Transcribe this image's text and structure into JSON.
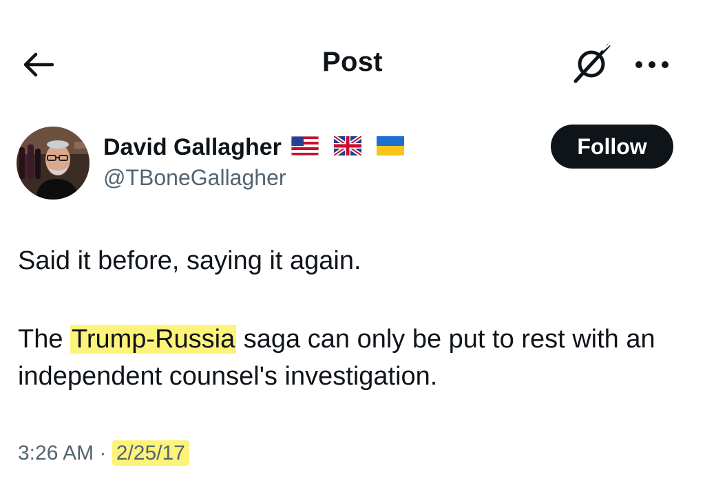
{
  "header": {
    "title": "Post"
  },
  "author": {
    "name": "David Gallagher",
    "handle": "@TBoneGallagher",
    "flags": [
      "us-flag",
      "uk-flag",
      "ukraine-flag"
    ]
  },
  "follow_label": "Follow",
  "post": {
    "line1": "Said it before, saying it again.",
    "pre_highlight": "The ",
    "highlight": "Trump-Russia",
    "post_highlight": " saga can only be put to rest with an independent counsel's investigation."
  },
  "meta": {
    "time": "3:26 AM",
    "separator": " · ",
    "date": "2/25/17"
  },
  "colors": {
    "text": "#0f1419",
    "secondary": "#536471",
    "highlight": "#fdf37a",
    "button_bg": "#0f1419"
  }
}
